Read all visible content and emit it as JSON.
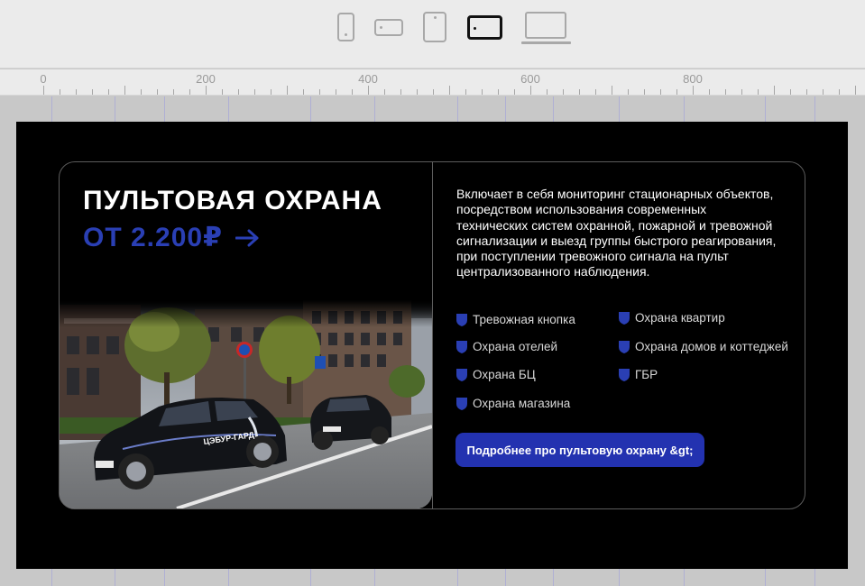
{
  "toolbar": {
    "devices": [
      "mobile-icon",
      "mobile-landscape-icon",
      "tablet-icon",
      "tablet-landscape-icon",
      "laptop-icon"
    ],
    "active_device": "tablet-landscape-icon"
  },
  "ruler": {
    "labels": [
      "0",
      "200",
      "400",
      "600",
      "800"
    ]
  },
  "hero": {
    "title": "ПУЛЬТОВАЯ ОХРАНА",
    "price": "ОТ 2.200₽",
    "description": "Включает в себя мониторинг стационарных объектов, посредством использования современных технических систем охранной, пожарной и тревожной сигнализации и выезд группы быстрого реагирования, при поступлении тревожного сигнала на пульт централизованного наблюдения.",
    "features": [
      "Тревожная кнопка",
      "Охрана квартир",
      "Охрана отелей",
      "Охрана домов и коттеджей",
      "Охрана БЦ",
      "ГБР",
      "Охрана магазина"
    ],
    "cta_label": "Подробнее про пультовую охрану &gt;",
    "car_text": "ЦЭБУР-ГАРД",
    "accent_color": "#2a3fb4",
    "button_color": "#2332b0"
  }
}
